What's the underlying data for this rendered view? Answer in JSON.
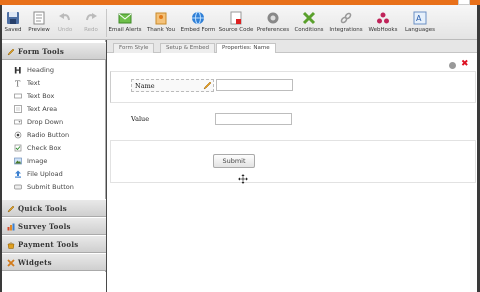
{
  "toolbar": {
    "buttons": [
      {
        "label": "Saved",
        "icon": "save-icon",
        "enabled": true
      },
      {
        "label": "Preview",
        "icon": "preview-icon",
        "enabled": true
      },
      {
        "label": "Undo",
        "icon": "undo-icon",
        "enabled": false
      },
      {
        "label": "Redo",
        "icon": "redo-icon",
        "enabled": false
      },
      {
        "label": "Email Alerts",
        "icon": "email-alerts-icon",
        "enabled": true
      },
      {
        "label": "Thank You",
        "icon": "thank-you-icon",
        "enabled": true
      },
      {
        "label": "Embed Form",
        "icon": "embed-form-icon",
        "enabled": true
      },
      {
        "label": "Source Code",
        "icon": "source-code-icon",
        "enabled": true
      },
      {
        "label": "Preferences",
        "icon": "preferences-icon",
        "enabled": true
      },
      {
        "label": "Conditions",
        "icon": "conditions-icon",
        "enabled": true
      },
      {
        "label": "Integrations",
        "icon": "integrations-icon",
        "enabled": true
      },
      {
        "label": "WebHooks",
        "icon": "webhooks-icon",
        "enabled": true
      },
      {
        "label": "Languages",
        "icon": "languages-icon",
        "enabled": true
      }
    ]
  },
  "sidebar": {
    "form_tools": {
      "title": "Form Tools",
      "items": [
        {
          "label": "Heading",
          "icon": "heading-icon"
        },
        {
          "label": "Text",
          "icon": "text-icon"
        },
        {
          "label": "Text Box",
          "icon": "text-box-icon"
        },
        {
          "label": "Text Area",
          "icon": "text-area-icon"
        },
        {
          "label": "Drop Down",
          "icon": "drop-down-icon"
        },
        {
          "label": "Radio Button",
          "icon": "radio-button-icon"
        },
        {
          "label": "Check Box",
          "icon": "check-box-icon"
        },
        {
          "label": "Image",
          "icon": "image-icon"
        },
        {
          "label": "File Upload",
          "icon": "file-upload-icon"
        },
        {
          "label": "Submit Button",
          "icon": "submit-button-icon"
        }
      ]
    },
    "sections": [
      {
        "title": "Quick Tools",
        "icon": "pencil-icon"
      },
      {
        "title": "Survey Tools",
        "icon": "chart-icon"
      },
      {
        "title": "Payment Tools",
        "icon": "payment-icon"
      },
      {
        "title": "Widgets",
        "icon": "widgets-icon"
      }
    ]
  },
  "tabs": [
    {
      "label": "Form Style"
    },
    {
      "label": "Setup & Embed"
    },
    {
      "label": "Properties: Name"
    }
  ],
  "form": {
    "name_label": "Name",
    "value_label": "Value",
    "submit_label": "Submit"
  },
  "colors": {
    "accent": "#e8701a",
    "delete": "#dd1122"
  }
}
